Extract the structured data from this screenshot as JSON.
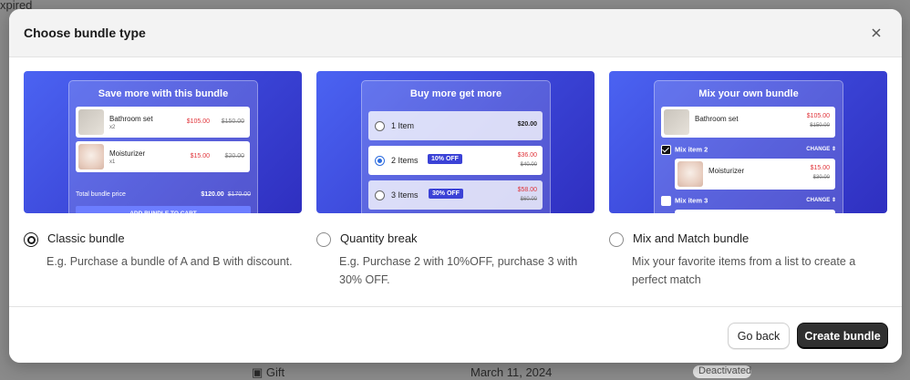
{
  "background": {
    "status_text": "xpired",
    "row_name": "Gift",
    "row_date": "March 11, 2024",
    "row_status": "Deactivated"
  },
  "modal": {
    "title": "Choose bundle type",
    "close_icon": "close-icon"
  },
  "classic_preview": {
    "heading": "Save more with this bundle",
    "items": [
      {
        "name": "Bathroom set",
        "qty": "x2",
        "price": "$105.00",
        "old_price": "$150.00"
      },
      {
        "name": "Moisturizer",
        "qty": "x1",
        "price": "$15.00",
        "old_price": "$20.00"
      }
    ],
    "total_label": "Total bundle price",
    "total_price": "$120.00",
    "total_old": "$170.00",
    "button": "ADD BUNDLE TO CART"
  },
  "quantity_preview": {
    "heading": "Buy more get more",
    "rows": [
      {
        "label": "1 Item",
        "tag": "",
        "price": "$20.00",
        "old_price": ""
      },
      {
        "label": "2 Items",
        "tag": "10% OFF",
        "price": "$36.00",
        "old_price": "$40.00"
      },
      {
        "label": "3 Items",
        "tag": "30% OFF",
        "price": "$58.00",
        "old_price": "$60.00"
      }
    ]
  },
  "mix_preview": {
    "heading": "Mix your own bundle",
    "item1": {
      "name": "Bathroom set",
      "price": "$105.00",
      "old_price": "$150.00"
    },
    "mix2": {
      "label": "Mix item 2",
      "change": "CHANGE"
    },
    "item2": {
      "name": "Moisturizer",
      "price": "$15.00",
      "old_price": "$30.00"
    },
    "mix3": {
      "label": "Mix item 3",
      "change": "CHANGE"
    }
  },
  "options": [
    {
      "label": "Classic bundle",
      "description": "E.g. Purchase a bundle of A and B with discount.",
      "selected": true
    },
    {
      "label": "Quantity break",
      "description": "E.g. Purchase 2 with 10%OFF, purchase 3 with 30% OFF.",
      "selected": false
    },
    {
      "label": "Mix and Match bundle",
      "description": "Mix your favorite items from a list to create a perfect match",
      "selected": false
    }
  ],
  "footer": {
    "back_label": "Go back",
    "create_label": "Create bundle"
  },
  "colors": {
    "accent": "#303030",
    "preview_gradient": "#3a44d6",
    "sale_red": "#e0343a"
  }
}
